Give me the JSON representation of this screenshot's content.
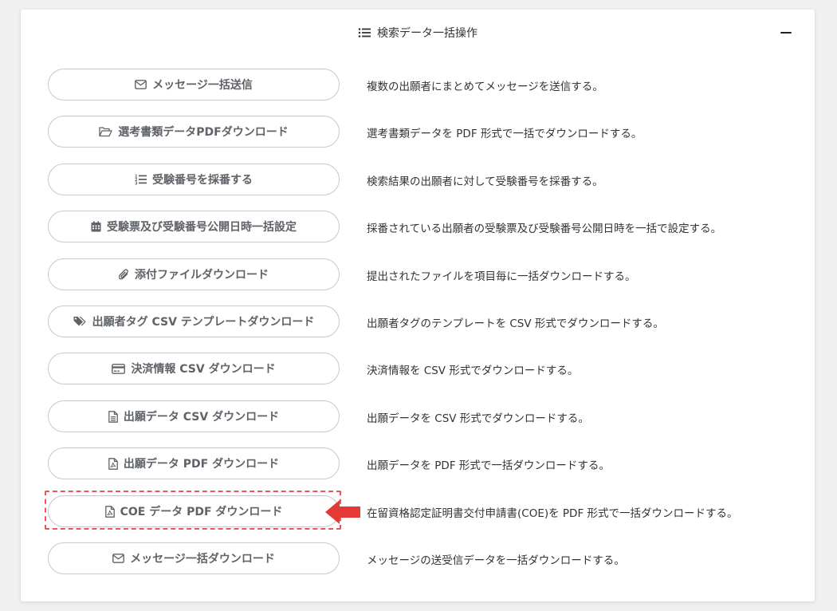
{
  "header": {
    "title": "検索データ一括操作",
    "title_icon": "list-icon",
    "collapse_icon": "minus-icon"
  },
  "operations": [
    {
      "label": "メッセージ一括送信",
      "icon": "envelope-icon",
      "description": "複数の出願者にまとめてメッセージを送信する。"
    },
    {
      "label": "選考書類データPDFダウンロード",
      "icon": "folder-open-icon",
      "description": "選考書類データを PDF 形式で一括でダウンロードする。"
    },
    {
      "label": "受験番号を採番する",
      "icon": "list-ol-icon",
      "description": "検索結果の出願者に対して受験番号を採番する。"
    },
    {
      "label": "受験票及び受験番号公開日時一括設定",
      "icon": "calendar-icon",
      "description": "採番されている出願者の受験票及び受験番号公開日時を一括で設定する。"
    },
    {
      "label": "添付ファイルダウンロード",
      "icon": "paperclip-icon",
      "description": "提出されたファイルを項目毎に一括ダウンロードする。"
    },
    {
      "label": "出願者タグ CSV テンプレートダウンロード",
      "icon": "tags-icon",
      "description": "出願者タグのテンプレートを CSV 形式でダウンロードする。"
    },
    {
      "label": "決済情報 CSV ダウンロード",
      "icon": "credit-card-icon",
      "description": "決済情報を CSV 形式でダウンロードする。"
    },
    {
      "label": "出願データ CSV ダウンロード",
      "icon": "file-text-icon",
      "description": "出願データを CSV 形式でダウンロードする。"
    },
    {
      "label": "出願データ PDF ダウンロード",
      "icon": "file-pdf-icon",
      "description": "出願データを PDF 形式で一括ダウンロードする。"
    },
    {
      "label": "COE データ PDF ダウンロード",
      "icon": "file-pdf-icon",
      "description": "在留資格認定証明書交付申請書(COE)を PDF 形式で一括ダウンロードする。",
      "highlighted": true
    },
    {
      "label": "メッセージ一括ダウンロード",
      "icon": "envelope-icon",
      "description": "メッセージの送受信データを一括ダウンロードする。"
    }
  ],
  "colors": {
    "highlight": "#ef5350",
    "button_text": "#5f6368",
    "button_border": "#c8c8c8"
  }
}
